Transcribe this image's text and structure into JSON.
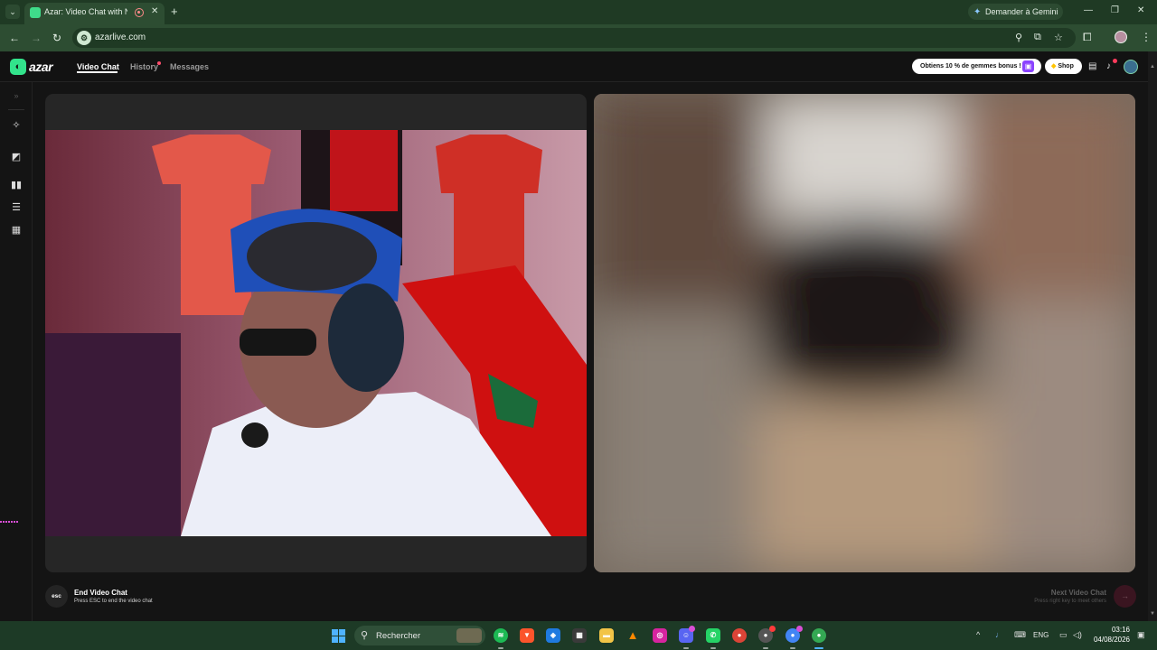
{
  "browser": {
    "tab_title": "Azar: Video Chat with New",
    "tab_close": "✕",
    "new_tab": "+",
    "gemini_label": "Demander à Gemini",
    "url": "azarlive.com",
    "window_minimize": "—",
    "window_restore": "❐",
    "window_close": "✕"
  },
  "app": {
    "logo_text": "azar",
    "nav": {
      "video_chat": "Video Chat",
      "history": "History",
      "messages": "Messages"
    },
    "promo_label": "Obtiens 10 % de gemmes bonus !",
    "shop_label": "Shop",
    "accent_color": "#32e38b"
  },
  "bottom": {
    "esc_key": "esc",
    "end_title": "End Video Chat",
    "end_subtitle": "Press ESC to end the video chat",
    "next_title": "Next Video Chat",
    "next_subtitle": "Press right key to meet others",
    "next_arrow": "→"
  },
  "taskbar": {
    "search_label": "Rechercher",
    "language": "ENG",
    "time": "03:16",
    "date": "04/08/2026",
    "apps": [
      "spotify-icon",
      "brave-icon",
      "defender-icon",
      "store-icon",
      "file-explorer-icon",
      "vlc-icon",
      "instagram-icon",
      "discord-icon",
      "whatsapp-icon",
      "chrome-icon",
      "chrome-profile-icon",
      "chrome-profile-2-icon",
      "chrome-profile-3-icon"
    ]
  }
}
